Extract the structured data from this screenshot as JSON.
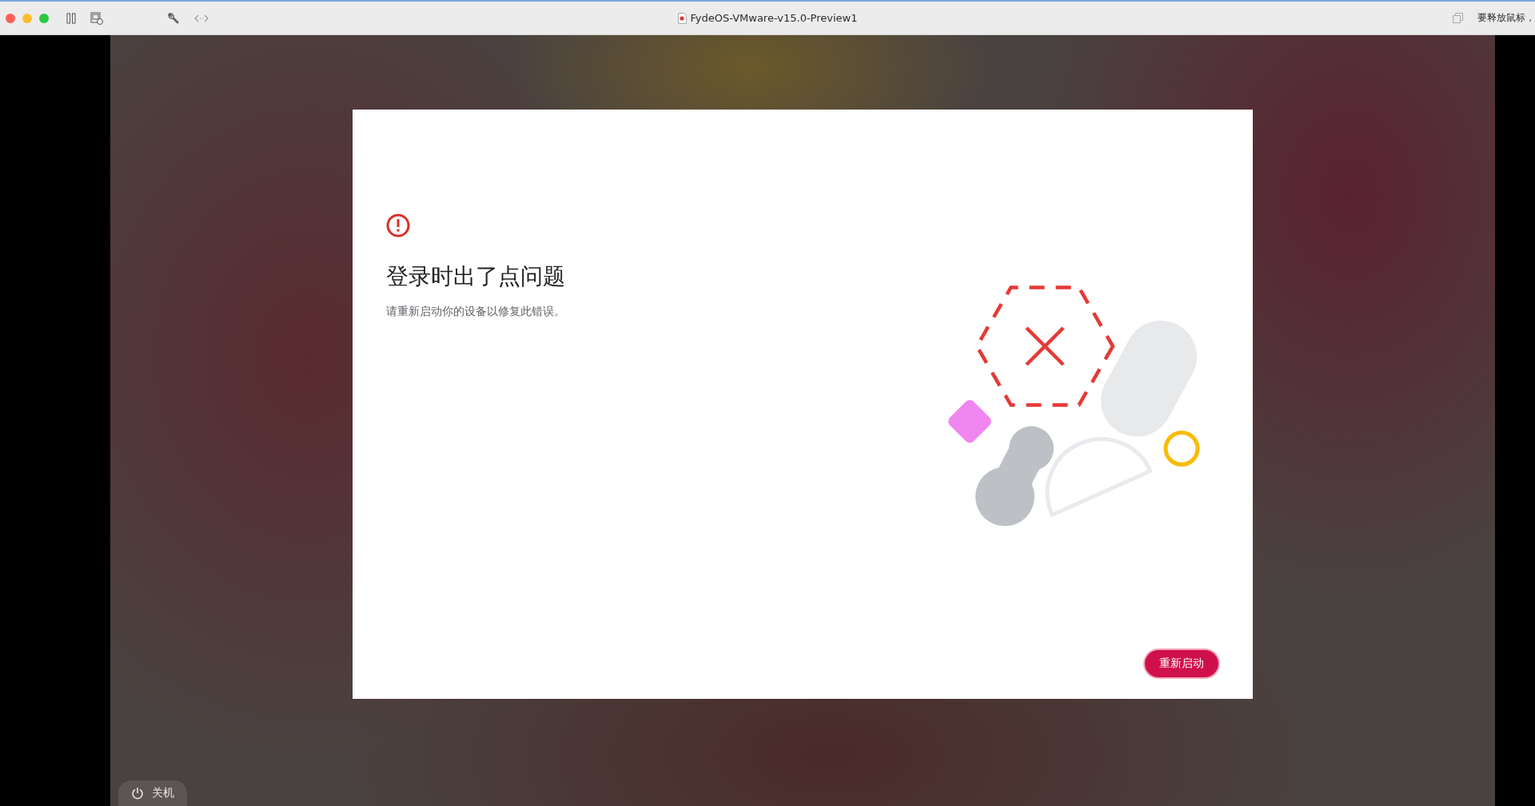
{
  "window": {
    "title": "FydeOS-VMware-v15.0-Preview1",
    "release_hint": "要释放鼠标，"
  },
  "dialog": {
    "title": "登录时出了点问题",
    "message": "请重新启动你的设备以修复此错误。",
    "button": "重新启动"
  },
  "shelf": {
    "shutdown_label": "关机"
  }
}
